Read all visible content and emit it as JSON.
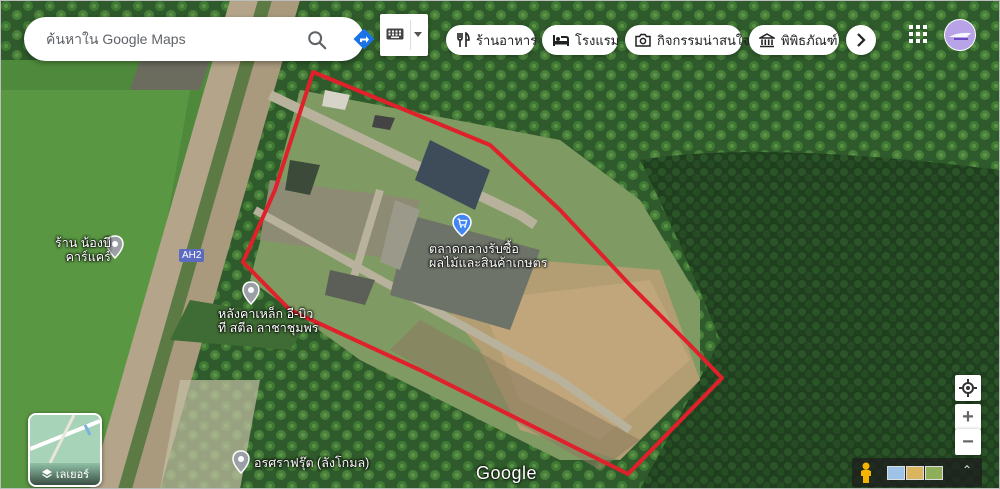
{
  "search": {
    "placeholder": "ค้นหาใน Google Maps"
  },
  "icons": {
    "search": "search-icon",
    "directions": "directions-icon",
    "keyboard": "keyboard-icon",
    "apps": "apps-grid-icon",
    "layers": "layers-icon",
    "location": "my-location-icon"
  },
  "chips": [
    {
      "label": "ร้านอาหาร",
      "icon": "restaurant-icon"
    },
    {
      "label": "โรงแรม",
      "icon": "hotel-icon"
    },
    {
      "label": "กิจกรรมน่าสนใจ",
      "icon": "camera-icon"
    },
    {
      "label": "พิพิธภัณฑ์",
      "icon": "museum-icon"
    }
  ],
  "map": {
    "highway_shield": "AH2",
    "places": [
      {
        "name_line1": "ตลาดกลางรับซื้อ",
        "name_line2": "ผลไม้และสินค้าเกษตร",
        "pin_color": "#4285f4"
      },
      {
        "name_line1": "ร้าน น้องบี",
        "name_line2": "คาร์แคร์",
        "pin_color": "#9aa0a6"
      },
      {
        "name_line1": "หลังคาเหล็ก อี-บิว",
        "name_line2": "ที สตีล ลาชาชุมพร",
        "pin_color": "#9aa0a6"
      },
      {
        "name_line1": "อรศราฟรุ๊ต (ลังโกมล)",
        "name_line2": "",
        "pin_color": "#9aa0a6"
      }
    ],
    "boundary_color": "#e0202a"
  },
  "layers": {
    "label": "เลเยอร์"
  },
  "branding": {
    "logo": "Google"
  },
  "controls": {
    "zoom_in": "+",
    "zoom_out": "−",
    "expand": "⌃"
  },
  "colors": {
    "accent": "#1a73e8"
  }
}
